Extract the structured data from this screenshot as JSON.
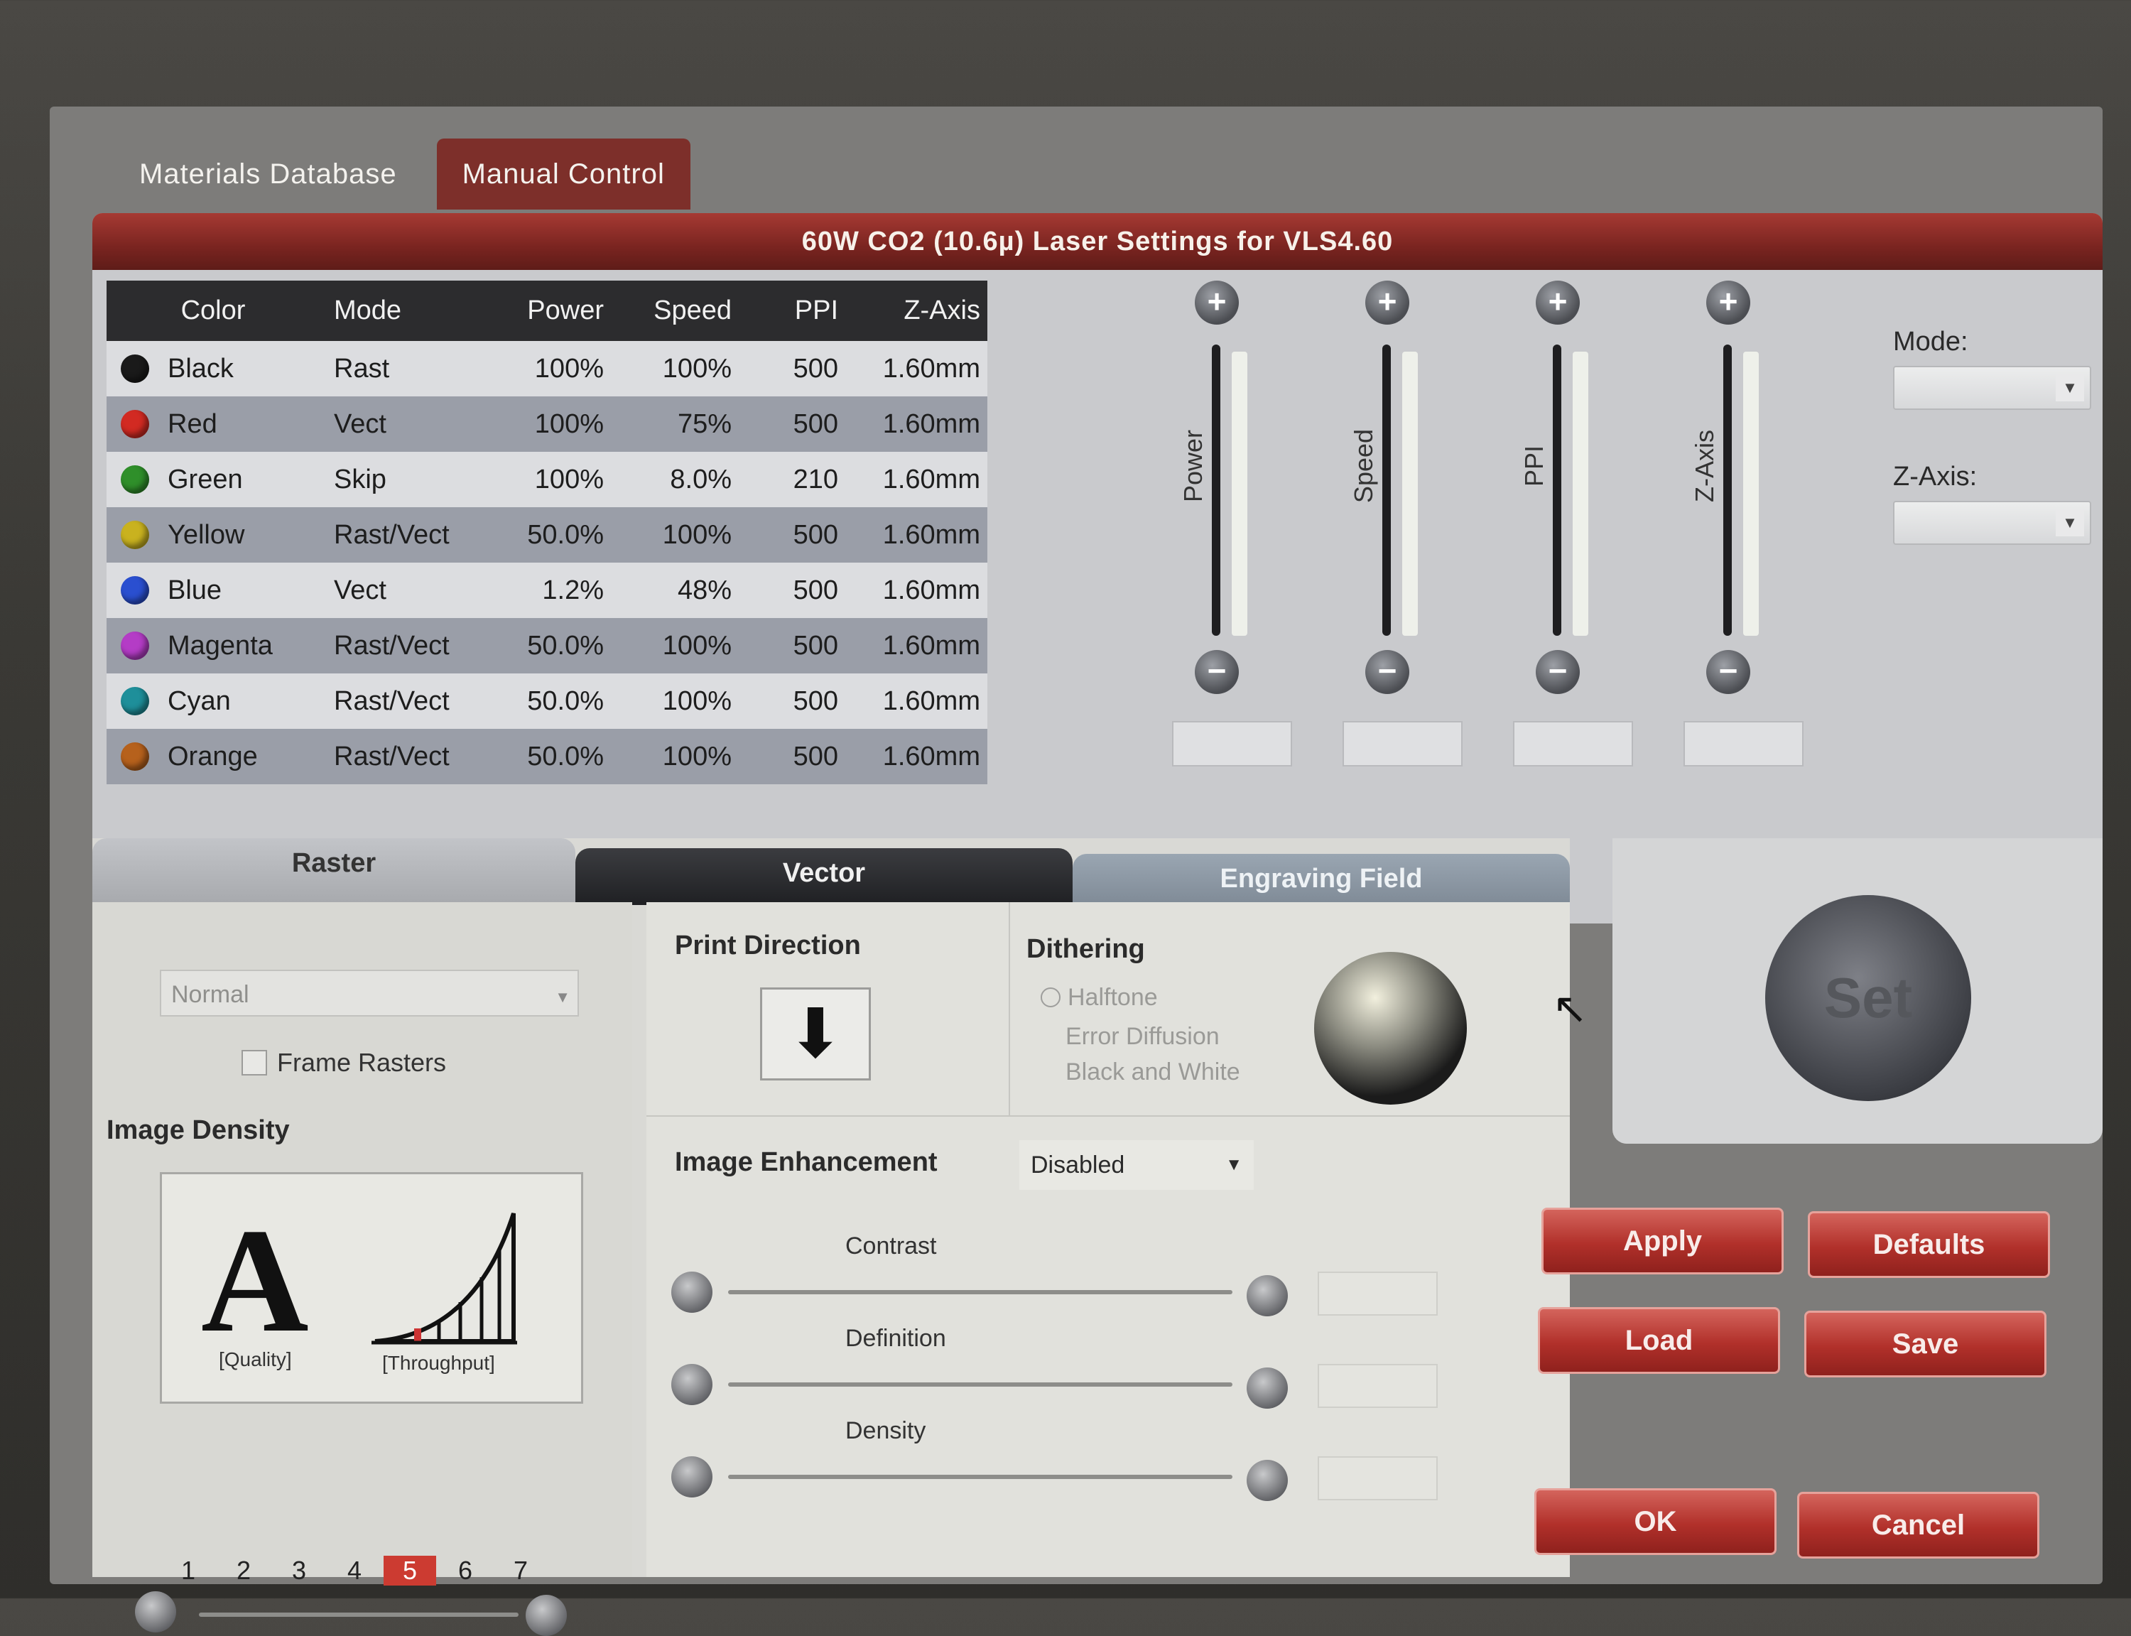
{
  "tabs": [
    "Materials Database",
    "Manual Control"
  ],
  "panel_title": "60W CO2 (10.6µ) Laser Settings for VLS4.60",
  "table": {
    "headers": [
      "Color",
      "Mode",
      "Power",
      "Speed",
      "PPI",
      "Z-Axis"
    ],
    "rows": [
      {
        "color": "Black",
        "dot": "#1a1a1a",
        "mode": "Rast",
        "power": "100%",
        "speed": "100%",
        "ppi": "500",
        "z": "1.60mm"
      },
      {
        "color": "Red",
        "dot": "#d22a22",
        "mode": "Vect",
        "power": "100%",
        "speed": "75%",
        "ppi": "500",
        "z": "1.60mm"
      },
      {
        "color": "Green",
        "dot": "#2f8f2a",
        "mode": "Skip",
        "power": "100%",
        "speed": "8.0%",
        "ppi": "210",
        "z": "1.60mm"
      },
      {
        "color": "Yellow",
        "dot": "#c9b21f",
        "mode": "Rast/Vect",
        "power": "50.0%",
        "speed": "100%",
        "ppi": "500",
        "z": "1.60mm"
      },
      {
        "color": "Blue",
        "dot": "#2a4fd0",
        "mode": "Vect",
        "power": "1.2%",
        "speed": "48%",
        "ppi": "500",
        "z": "1.60mm"
      },
      {
        "color": "Magenta",
        "dot": "#b43cc6",
        "mode": "Rast/Vect",
        "power": "50.0%",
        "speed": "100%",
        "ppi": "500",
        "z": "1.60mm"
      },
      {
        "color": "Cyan",
        "dot": "#1e8f9a",
        "mode": "Rast/Vect",
        "power": "50.0%",
        "speed": "100%",
        "ppi": "500",
        "z": "1.60mm"
      },
      {
        "color": "Orange",
        "dot": "#b6611c",
        "mode": "Rast/Vect",
        "power": "50.0%",
        "speed": "100%",
        "ppi": "500",
        "z": "1.60mm"
      }
    ]
  },
  "sliders": [
    "Power",
    "Speed",
    "PPI",
    "Z-Axis"
  ],
  "side": {
    "mode_label": "Mode:",
    "zaxis_label": "Z-Axis:"
  },
  "lower_tabs": {
    "raster": "Raster",
    "vector": "Vector",
    "engraving": "Engraving Field"
  },
  "raster": {
    "mode_select": "Normal",
    "frame_rasters": "Frame Rasters",
    "image_density_title": "Image Density",
    "quality_label": "[Quality]",
    "throughput_label": "[Throughput]",
    "density_levels": [
      "1",
      "2",
      "3",
      "4",
      "5",
      "6",
      "7"
    ],
    "selected_level": "5"
  },
  "vector": {
    "print_direction": "Print Direction",
    "dithering_title": "Dithering",
    "dithering_options": [
      "Halftone",
      "Error Diffusion",
      "Black and White"
    ],
    "image_enhancement": "Image Enhancement",
    "enhancement_value": "Disabled",
    "contrast": "Contrast",
    "definition": "Definition",
    "density": "Density"
  },
  "set_button": "Set",
  "buttons": {
    "apply": "Apply",
    "defaults": "Defaults",
    "load": "Load",
    "save": "Save",
    "ok": "OK",
    "cancel": "Cancel"
  }
}
